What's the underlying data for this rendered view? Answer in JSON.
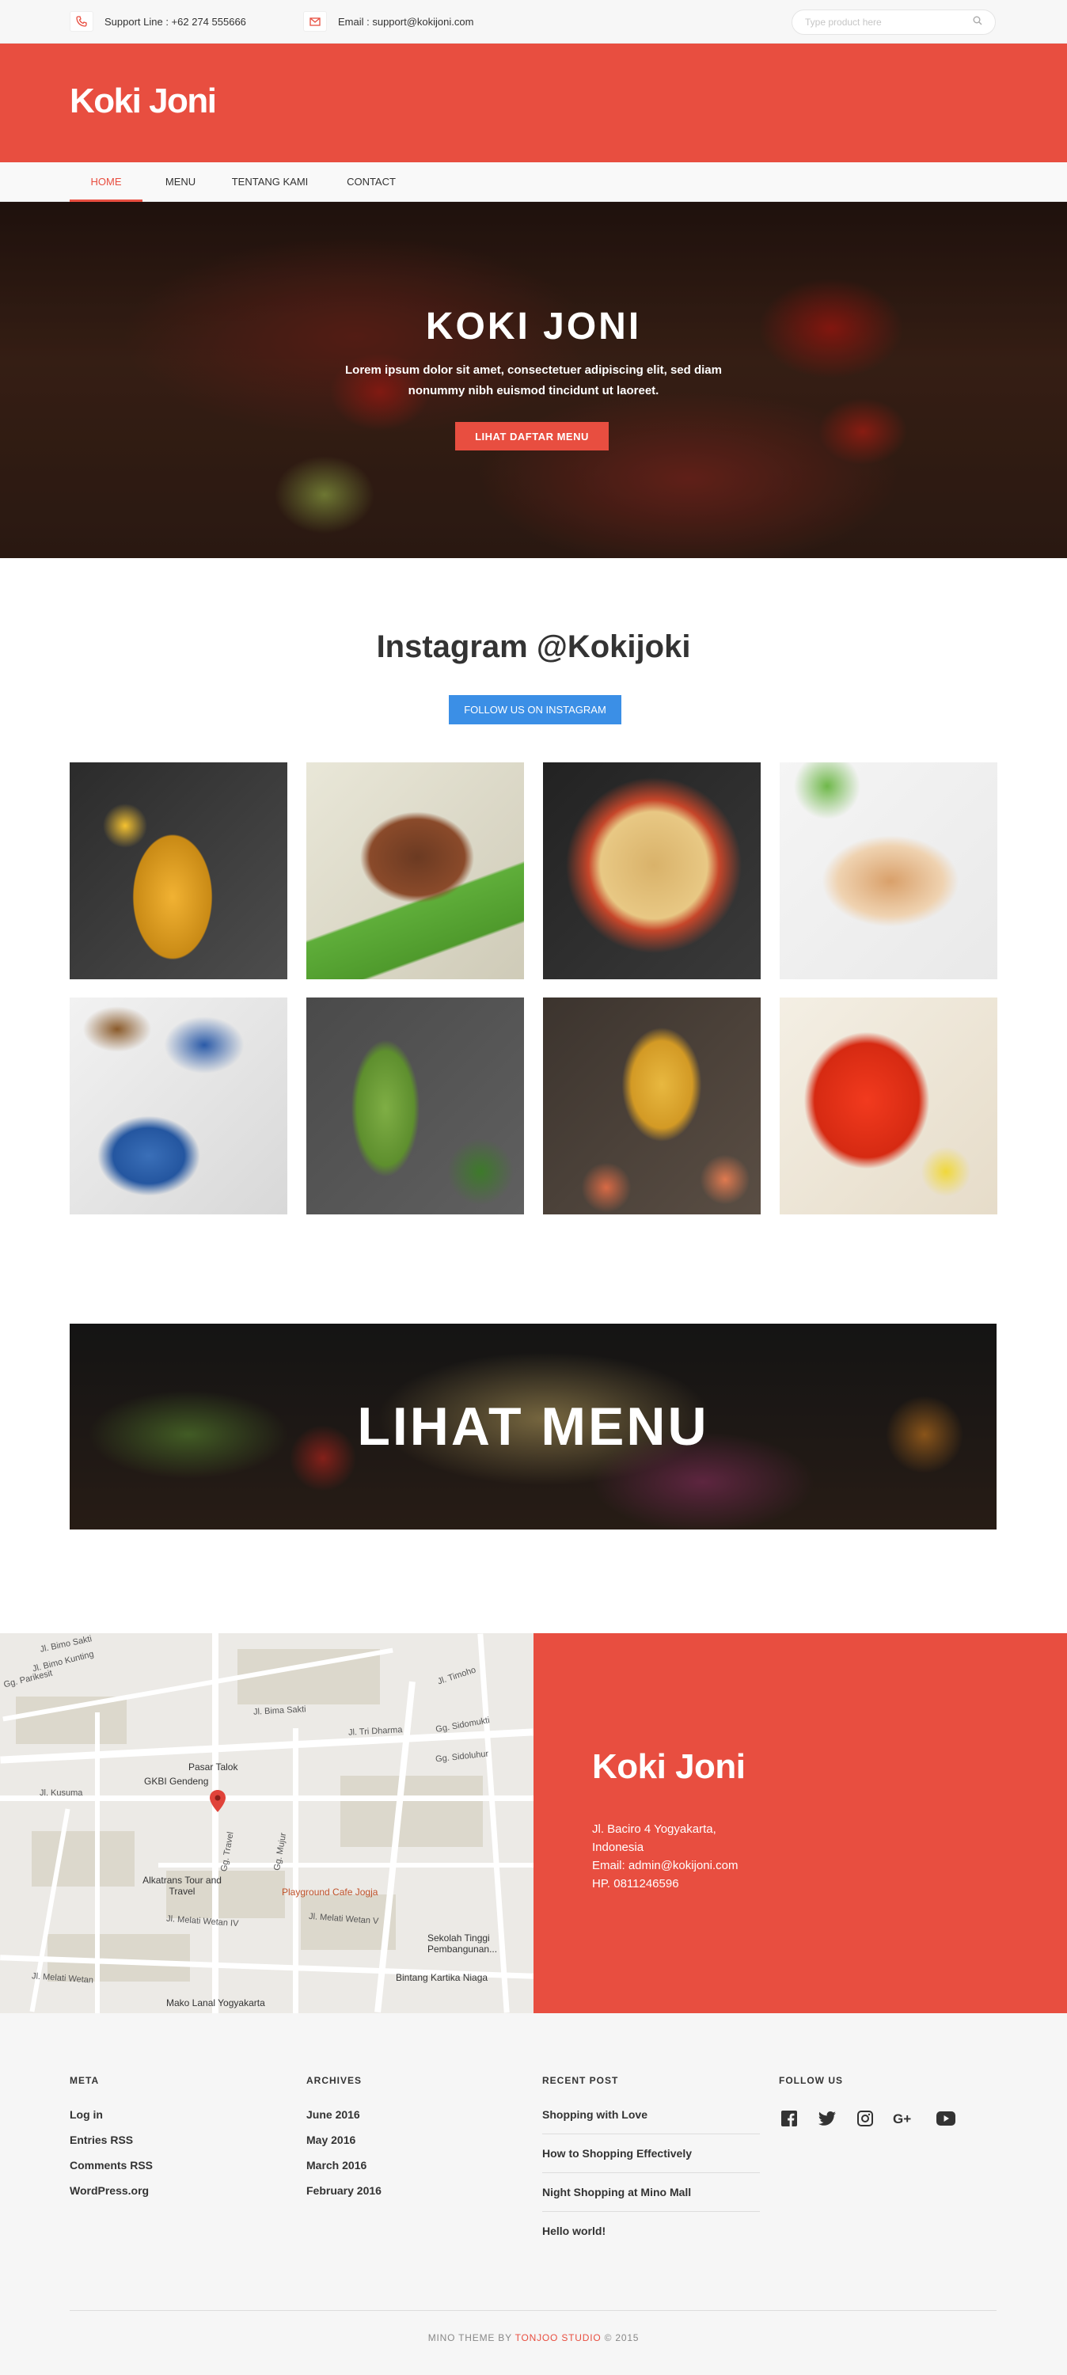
{
  "topbar": {
    "support": "Support Line : +62 274 555666",
    "email": "Email : support@kokijoni.com",
    "search_placeholder": "Type product here"
  },
  "brand": {
    "logo": "Koki Joni",
    "accent": "#e84e40"
  },
  "nav": {
    "items": [
      "HOME",
      "MENU",
      "TENTANG KAMI",
      "CONTACT"
    ],
    "active": "HOME"
  },
  "hero": {
    "title": "KOKI JONI",
    "text": "Lorem ipsum dolor sit amet, consectetuer adipiscing elit, sed diam nonummy nibh euismod tincidunt ut laoreet.",
    "button": "LIHAT DAFTAR MENU"
  },
  "instagram": {
    "title": "Instagram @Kokijoki",
    "button": "FOLLOW US ON INSTAGRAM",
    "button_color": "#3b8fe6"
  },
  "banner": {
    "text": "LIHAT MENU"
  },
  "map": {
    "streets": [
      "Jl. Bimo Sakti",
      "Jl. Bimo Kunting",
      "Gg. Parikesit",
      "Jl. Timoho",
      "Jl. Bima Sakti",
      "Jl. Tri Dharma",
      "Gg. Sidomukti",
      "Gg. Sidoluhur",
      "Jl. Kusuma",
      "Jl. Melati Wetan IV",
      "Jl. Melati Wetan V",
      "Jl. Melati Wetan",
      "Gg. Travel",
      "Gg. Mujur"
    ],
    "places": [
      "Pasar Talok",
      "GKBI Gendeng",
      "Alkatrans Tour and Travel",
      "Playground Cafe Jogja",
      "Sekolah Tinggi Pembangunan...",
      "Bintang Kartika Niaga",
      "Mako Lanal Yogyakarta"
    ]
  },
  "contact": {
    "title": "Koki Joni",
    "address1": "Jl. Baciro 4 Yogyakarta,",
    "address2": "Indonesia",
    "email": "Email: admin@kokijoni.com",
    "phone": "HP. 0811246596"
  },
  "footer": {
    "meta": {
      "heading": "META",
      "links": [
        "Log in",
        "Entries RSS",
        "Comments RSS",
        "WordPress.org"
      ]
    },
    "archives": {
      "heading": "ARCHIVES",
      "links": [
        "June 2016",
        "May 2016",
        "March 2016",
        "February 2016"
      ]
    },
    "recent": {
      "heading": "RECENT POST",
      "links": [
        "Shopping with Love",
        "How to Shopping Effectively",
        "Night Shopping at Mino Mall",
        "Hello world!"
      ]
    },
    "follow": {
      "heading": "FOLLOW US",
      "icons": [
        "facebook-icon",
        "twitter-icon",
        "instagram-icon",
        "google-plus-icon",
        "youtube-icon"
      ]
    },
    "copyright_pre": "MINO THEME BY ",
    "copyright_studio": "TONJOO STUDIO",
    "copyright_post": " © 2015"
  }
}
